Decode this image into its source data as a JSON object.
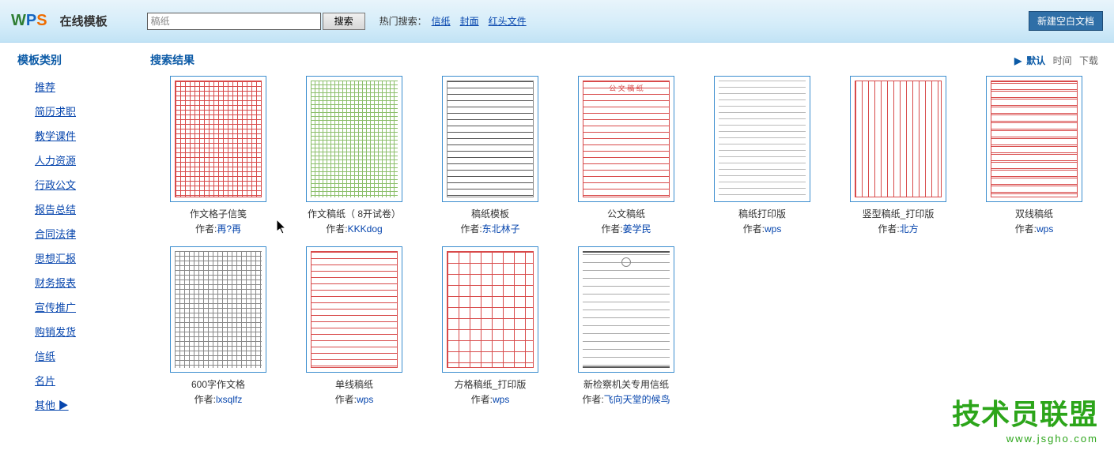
{
  "header": {
    "brand_text": "在线模板",
    "search_value": "稿纸",
    "search_button": "搜索",
    "hot_label": "热门搜索：",
    "hot_links": [
      "信纸",
      "封面",
      "红头文件"
    ],
    "new_blank": "新建空白文档"
  },
  "sidebar": {
    "title": "模板类别",
    "items": [
      "推荐",
      "简历求职",
      "教学课件",
      "人力资源",
      "行政公文",
      "报告总结",
      "合同法律",
      "思想汇报",
      "财务报表",
      "宣传推广",
      "购销发货",
      "信纸",
      "名片",
      "其他 ▶"
    ]
  },
  "content": {
    "result_title": "搜索结果",
    "sort_prefix": "▶",
    "sort": {
      "default": "默认",
      "time": "时间",
      "download": "下载"
    }
  },
  "author_label": "作者:",
  "templates": [
    {
      "title": "作文格子信笺",
      "author": "再?再",
      "style": "red-grid"
    },
    {
      "title": "作文稿纸（ 8开试卷）",
      "author": "KKKdog",
      "style": "mix-grid"
    },
    {
      "title": "稿纸模板",
      "author": "东北林子",
      "style": "ruled-black"
    },
    {
      "title": "公文稿纸",
      "author": "姜学民",
      "style": "ruled-red ruled-red-head"
    },
    {
      "title": "稿纸打印版",
      "author": "wps",
      "style": "ruled-gray"
    },
    {
      "title": "竖型稿纸_打印版",
      "author": "北方",
      "style": "vert-red"
    },
    {
      "title": "双线稿纸",
      "author": "wps",
      "style": "double-red"
    },
    {
      "title": "600字作文格",
      "author": "lxsqlfz",
      "style": "grid-gray"
    },
    {
      "title": "单线稿纸",
      "author": "wps",
      "style": "ruled-red"
    },
    {
      "title": "方格稿纸_打印版",
      "author": "wps",
      "style": "coarse-red-grid"
    },
    {
      "title": "新检察机关专用信纸",
      "author": "飞向天堂的候鸟",
      "style": "letter-top letter-lines"
    }
  ],
  "watermark": {
    "big": "技术员联盟",
    "small": "www.jsgho.com"
  }
}
